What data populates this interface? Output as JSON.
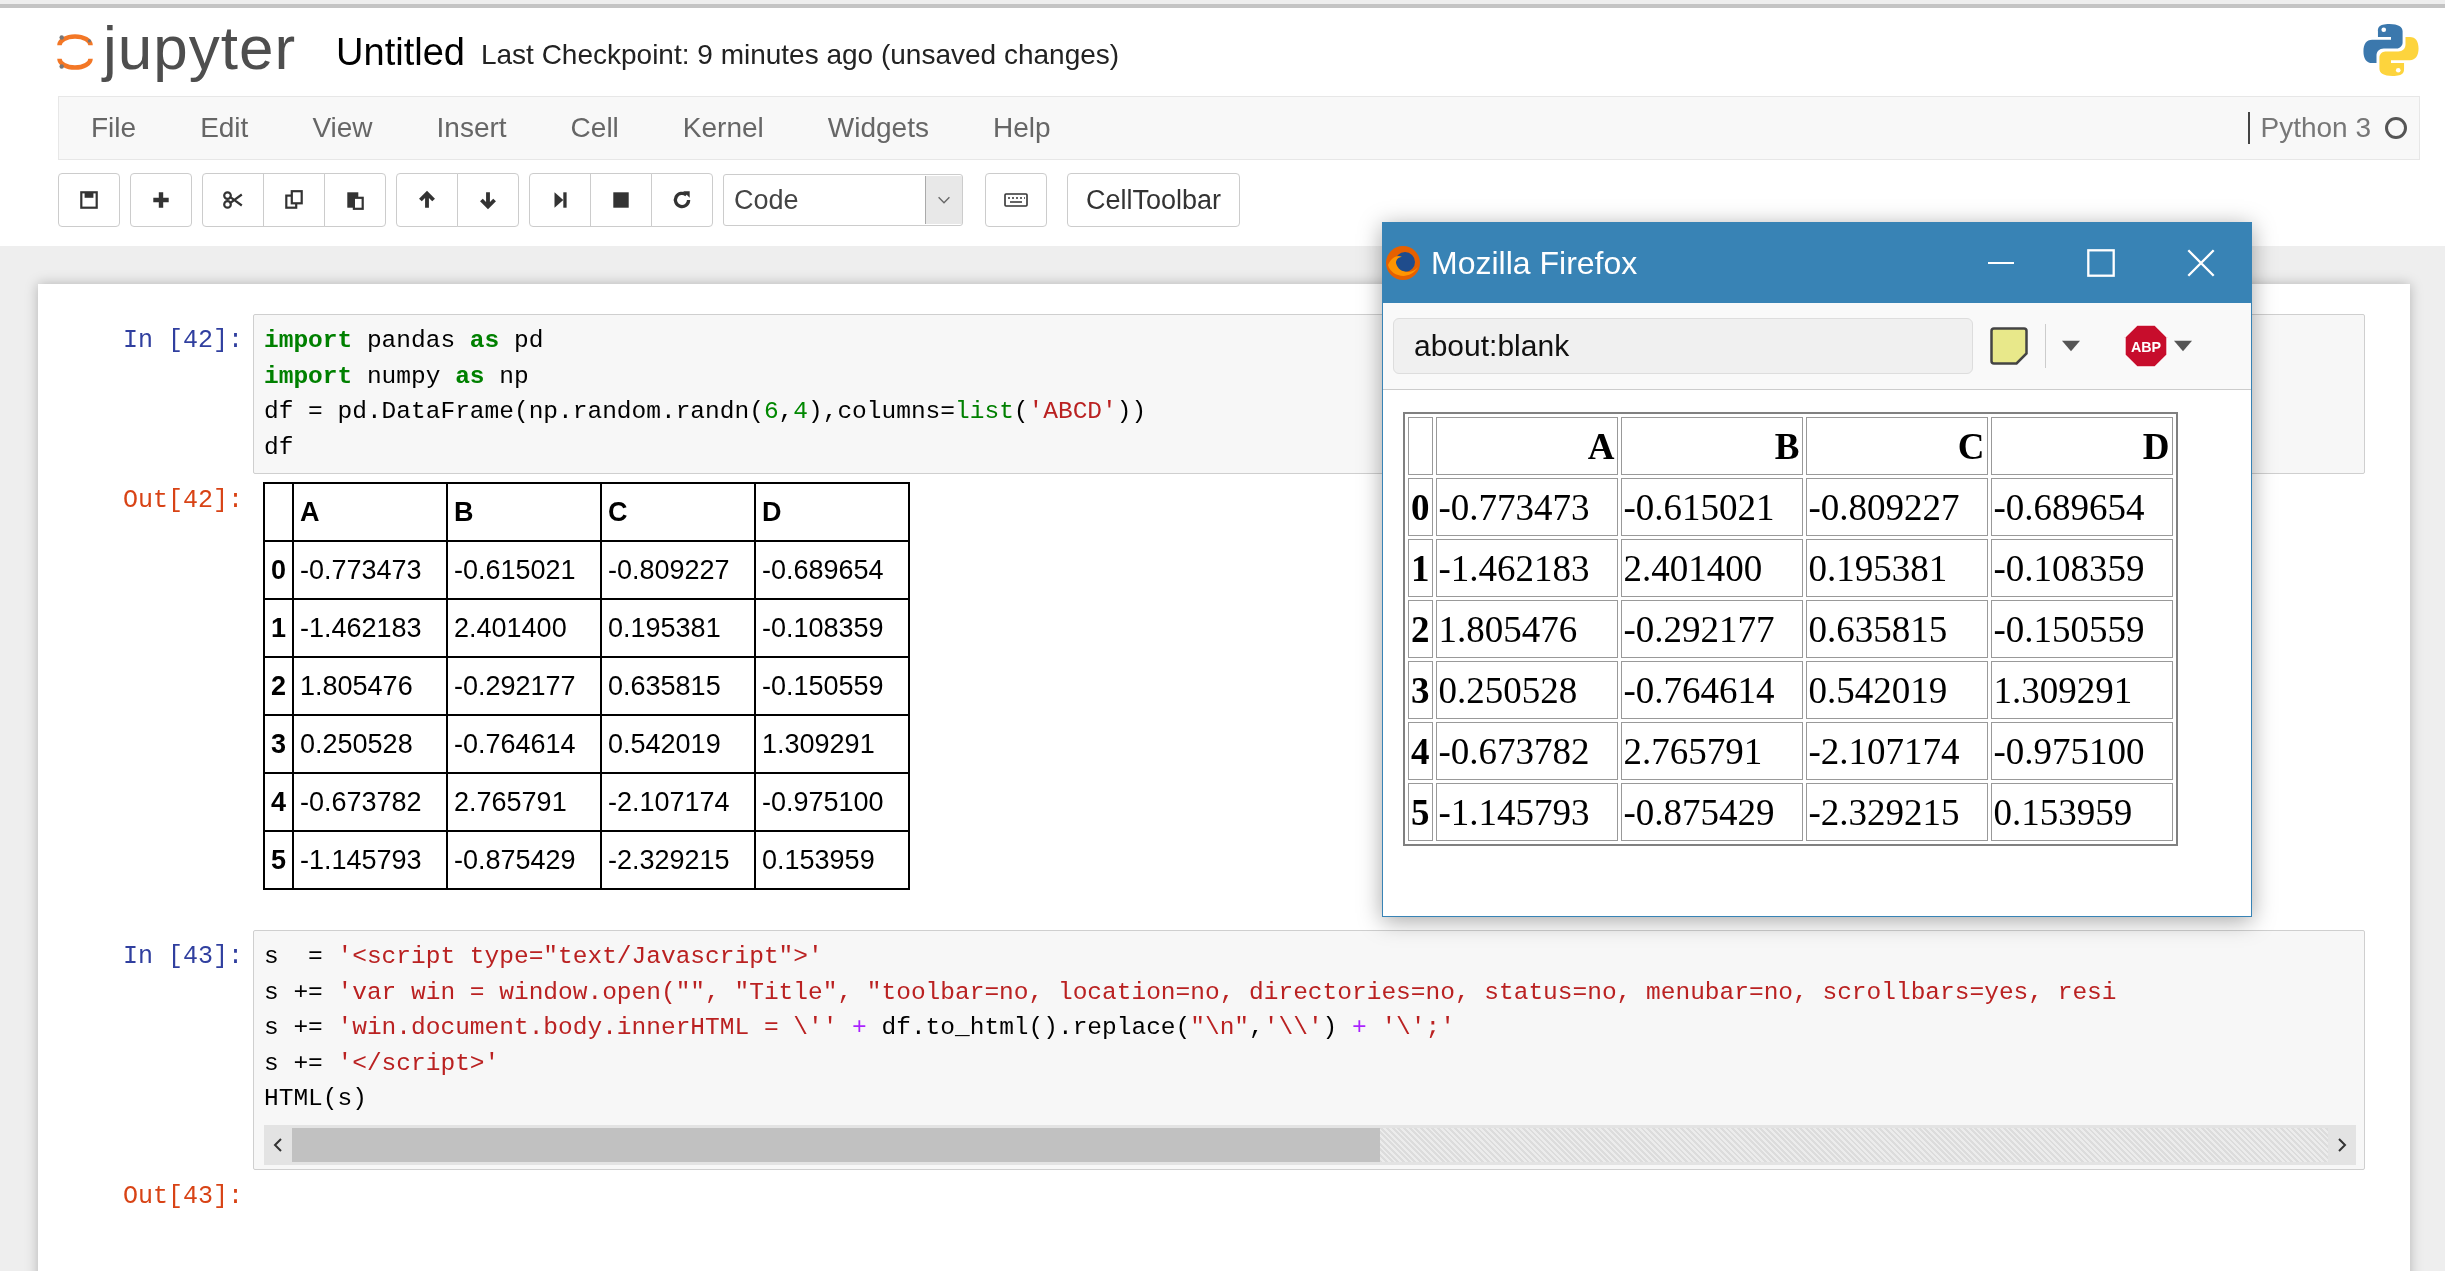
{
  "header": {
    "logo_text": "jupyter",
    "notebook_name": "Untitled",
    "checkpoint": "Last Checkpoint: 9 minutes ago (unsaved changes)"
  },
  "menu": [
    "File",
    "Edit",
    "View",
    "Insert",
    "Cell",
    "Kernel",
    "Widgets",
    "Help"
  ],
  "kernel": {
    "name": "Python 3",
    "busy": false
  },
  "toolbar": {
    "cell_type": "Code",
    "celltoolbar": "CellToolbar"
  },
  "cells": [
    {
      "prompt": "In [42]:",
      "lines": [
        [
          {
            "text": "import",
            "kind": "keyword"
          },
          {
            "text": " pandas ",
            "kind": "plain"
          },
          {
            "text": "as",
            "kind": "keyword"
          },
          {
            "text": " pd",
            "kind": "plain"
          }
        ],
        [
          {
            "text": "import",
            "kind": "keyword"
          },
          {
            "text": " numpy ",
            "kind": "plain"
          },
          {
            "text": "as",
            "kind": "keyword"
          },
          {
            "text": " np",
            "kind": "plain"
          }
        ],
        [
          {
            "text": "df = pd.DataFrame(np.random.randn(",
            "kind": "plain"
          },
          {
            "text": "6",
            "kind": "number"
          },
          {
            "text": ",",
            "kind": "plain"
          },
          {
            "text": "4",
            "kind": "number"
          },
          {
            "text": "),columns=",
            "kind": "plain"
          },
          {
            "text": "list",
            "kind": "builtin"
          },
          {
            "text": "(",
            "kind": "plain"
          },
          {
            "text": "'ABCD'",
            "kind": "string"
          },
          {
            "text": "))",
            "kind": "plain"
          }
        ],
        [
          {
            "text": "df",
            "kind": "plain"
          }
        ]
      ],
      "scrollbar": false,
      "output_prompt": "Out[42]:",
      "output": {
        "columns": [
          "A",
          "B",
          "C",
          "D"
        ],
        "rows": [
          {
            "index": "0",
            "values": [
              "-0.773473",
              "-0.615021",
              "-0.809227",
              "-0.689654"
            ]
          },
          {
            "index": "1",
            "values": [
              "-1.462183",
              "2.401400",
              "0.195381",
              "-0.108359"
            ]
          },
          {
            "index": "2",
            "values": [
              "1.805476",
              "-0.292177",
              "0.635815",
              "-0.150559"
            ]
          },
          {
            "index": "3",
            "values": [
              "0.250528",
              "-0.764614",
              "0.542019",
              "1.309291"
            ]
          },
          {
            "index": "4",
            "values": [
              "-0.673782",
              "2.765791",
              "-2.107174",
              "-0.975100"
            ]
          },
          {
            "index": "5",
            "values": [
              "-1.145793",
              "-0.875429",
              "-2.329215",
              "0.153959"
            ]
          }
        ]
      }
    },
    {
      "prompt": "In [43]:",
      "lines": [
        [
          {
            "text": "s  = ",
            "kind": "plain"
          },
          {
            "text": "'<script type=\"text/Javascript\">'",
            "kind": "string"
          }
        ],
        [
          {
            "text": "s += ",
            "kind": "plain"
          },
          {
            "text": "'var win = window.open(\"\", \"Title\", \"toolbar=no, location=no, directories=no, status=no, menubar=no, scrollbars=yes, resi",
            "kind": "string"
          }
        ],
        [
          {
            "text": "s += ",
            "kind": "plain"
          },
          {
            "text": "'win.document.body.innerHTML = \\'' ",
            "kind": "string"
          },
          {
            "text": "+",
            "kind": "operator"
          },
          {
            "text": " df.to_html().replace(",
            "kind": "plain"
          },
          {
            "text": "\"\\n\"",
            "kind": "string"
          },
          {
            "text": ",",
            "kind": "plain"
          },
          {
            "text": "'\\\\'",
            "kind": "string"
          },
          {
            "text": ") ",
            "kind": "plain"
          },
          {
            "text": "+",
            "kind": "operator"
          },
          {
            "text": " '\\';'",
            "kind": "string"
          }
        ],
        [
          {
            "text": "s += ",
            "kind": "plain"
          },
          {
            "text": "'</script>'",
            "kind": "string"
          }
        ],
        [
          {
            "text": "HTML(s)",
            "kind": "plain"
          }
        ]
      ],
      "scrollbar": true,
      "output_prompt": "Out[43]:"
    }
  ],
  "popup": {
    "title": "Mozilla Firefox",
    "url": "about:blank",
    "adblock_label": "ABP",
    "table": {
      "columns": [
        "A",
        "B",
        "C",
        "D"
      ],
      "rows": [
        {
          "index": "0",
          "values": [
            "-0.773473",
            "-0.615021",
            "-0.809227",
            "-0.689654"
          ]
        },
        {
          "index": "1",
          "values": [
            "-1.462183",
            "2.401400",
            "0.195381",
            "-0.108359"
          ]
        },
        {
          "index": "2",
          "values": [
            "1.805476",
            "-0.292177",
            "0.635815",
            "-0.150559"
          ]
        },
        {
          "index": "3",
          "values": [
            "0.250528",
            "-0.764614",
            "0.542019",
            "1.309291"
          ]
        },
        {
          "index": "4",
          "values": [
            "-0.673782",
            "2.765791",
            "-2.107174",
            "-0.975100"
          ]
        },
        {
          "index": "5",
          "values": [
            "-1.145793",
            "-0.875429",
            "-2.329215",
            "0.153959"
          ]
        }
      ]
    }
  }
}
